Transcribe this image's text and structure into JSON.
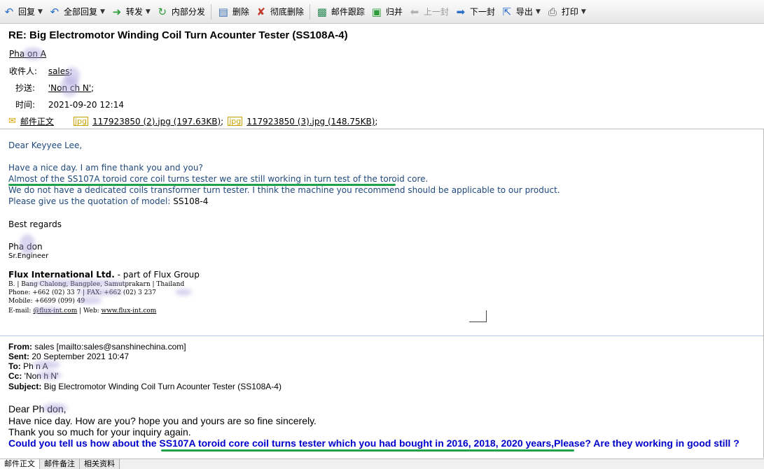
{
  "toolbar": {
    "reply": "回复",
    "reply_all": "全部回复",
    "forward": "转发",
    "internal_forward": "内部分发",
    "delete": "删除",
    "delete_permanent": "彻底删除",
    "track": "邮件跟踪",
    "archive": "归并",
    "prev": "上一封",
    "next": "下一封",
    "export": "导出",
    "print": "打印"
  },
  "header": {
    "subject": "RE: Big Electromotor Winding Coil Turn Acounter Tester (SS108A-4)",
    "from": "Pha      on A",
    "to_label": "收件人:",
    "to_value": "sales",
    "cc_label": "抄送:",
    "cc_value": "'Non      ch N'",
    "time_label": "时间:",
    "time_value": "2021-09-20 12:14",
    "body_link": "邮件正文",
    "attachments": [
      {
        "name": "117923850 (2).jpg (197.63KB)"
      },
      {
        "name": "117923850 (3).jpg (148.75KB)"
      }
    ]
  },
  "body": {
    "greeting": "Dear Keyyee Lee,",
    "line1": "Have a nice day. I am fine thank you and you?",
    "line2": "Almost of the SS107A toroid core coil turns tester we are still working in turn test of the toroid core.",
    "line3": "We do not have a dedicated coils transformer turn tester. I think the machine you recommend should be applicable to our product.",
    "line4_prefix": "Please give us the quotation of  model: ",
    "line4_model": "SS108-4",
    "regards": "Best regards",
    "sig_name": "Pha      don",
    "sig_title": "Sr.Engineer",
    "company": "Flux International Ltd.",
    "company_suffix": " - part of Flux Group",
    "address": "B.                                            | Bang Chalong, Bangplee, Samutprakarn | Thailand",
    "phone": "Phone: +662 (02) 33              7 | FAX: +662 (02) 3      237",
    "mobile": "Mobile: +6699 (099)          49",
    "email_prefix": "E-mail: ",
    "email": "        @flux-int.com",
    "web_prefix": " | Web: ",
    "web": "www.flux-int.com"
  },
  "quote": {
    "from_label": "From:",
    "from_value": " sales [mailto:sales@sanshinechina.com]",
    "sent_label": "Sent:",
    "sent_value": " 20 September 2021 10:47",
    "to_label": "To:",
    "to_value": " Ph      n A",
    "cc_label": "Cc:",
    "cc_value": " 'Non      h N'",
    "subject_label": "Subject:",
    "subject_value": " Big Electromotor Winding Coil Turn Acounter Tester (SS108A-4)",
    "dear": "Dear Ph        don,",
    "l1": "Have nice day. How are you? hope you and yours are so fine sincerely.",
    "l2": "Thank you so much for your inquiry again.",
    "l3": "Could you tell us how about the SS107A toroid core coil turns tester which you had bought in 2016, 2018, 2020 years,Please? Are they working in good still ?"
  },
  "tabs": [
    "邮件正文",
    "邮件备注",
    "相关资料"
  ],
  "colors": {
    "body_text": "#1f497d",
    "highlight": "#1fa34a",
    "quote_emphasis": "#0000cc"
  }
}
